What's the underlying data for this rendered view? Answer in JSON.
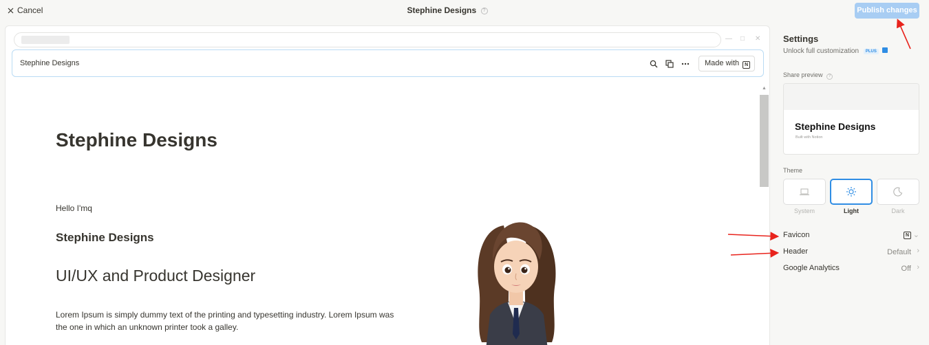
{
  "topbar": {
    "cancel_label": "Cancel",
    "page_title": "Stephine Designs",
    "help_mark": "?",
    "publish_label": "Publish changes"
  },
  "preview": {
    "header_title": "Stephine Designs",
    "made_with_label": "Made with",
    "notion_mark": "N",
    "page": {
      "title": "Stephine Designs",
      "greeting": "Hello I'mq",
      "heading3": "Stephine Designs",
      "heading2": "UI/UX and Product Designer",
      "paragraph": "Lorem Ipsum is simply dummy text of the printing and typesetting industry. Lorem Ipsum was the one in which an unknown printer took a galley."
    }
  },
  "settings": {
    "title": "Settings",
    "subtitle": "Unlock full customization",
    "plus_badge": "PLUS",
    "share_preview_label": "Share preview",
    "share_preview_help": "?",
    "share_card_title": "Stephine Designs",
    "share_card_subtitle": "Built with Notion",
    "theme_label": "Theme",
    "themes": [
      {
        "name": "System",
        "icon": "laptop-icon",
        "active": false
      },
      {
        "name": "Light",
        "icon": "sun-icon",
        "active": true
      },
      {
        "name": "Dark",
        "icon": "moon-icon",
        "active": false
      }
    ],
    "rows": {
      "favicon": {
        "label": "Favicon",
        "value_icon": "notion-logo-icon"
      },
      "header": {
        "label": "Header",
        "value": "Default"
      },
      "analytics": {
        "label": "Google Analytics",
        "value": "Off"
      }
    }
  },
  "colors": {
    "accent": "#2f8de4",
    "publish_bg": "#a8cdf3",
    "annotation_arrow": "#e8231c"
  }
}
